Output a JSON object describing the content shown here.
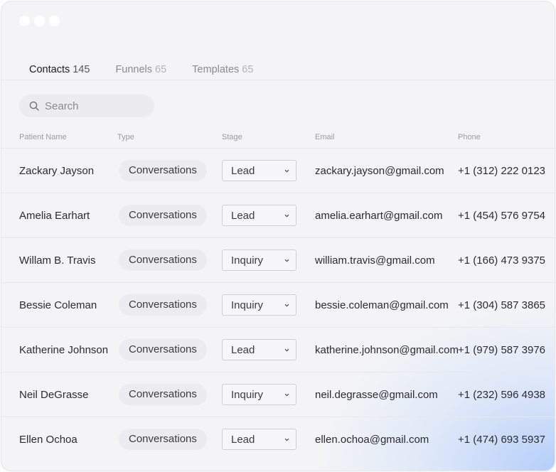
{
  "tabs": [
    {
      "label": "Contacts",
      "count": "145",
      "active": true
    },
    {
      "label": "Funnels",
      "count": "65",
      "active": false
    },
    {
      "label": "Templates",
      "count": "65",
      "active": false
    }
  ],
  "search": {
    "placeholder": "Search"
  },
  "columns": {
    "name": "Patient Name",
    "type": "Type",
    "stage": "Stage",
    "email": "Email",
    "phone": "Phone"
  },
  "rows": [
    {
      "name": "Zackary Jayson",
      "type": "Conversations",
      "stage": "Lead",
      "email": "zackary.jayson@gmail.com",
      "phone": "+1 (312) 222 0123"
    },
    {
      "name": "Amelia Earhart",
      "type": "Conversations",
      "stage": "Lead",
      "email": "amelia.earhart@gmail.com",
      "phone": "+1 (454) 576 9754"
    },
    {
      "name": "Willam B. Travis",
      "type": "Conversations",
      "stage": "Inquiry",
      "email": "william.travis@gmail.com",
      "phone": "+1 (166) 473 9375"
    },
    {
      "name": "Bessie Coleman",
      "type": "Conversations",
      "stage": "Inquiry",
      "email": "bessie.coleman@gmail.com",
      "phone": "+1 (304) 587 3865"
    },
    {
      "name": "Katherine Johnson",
      "type": "Conversations",
      "stage": "Lead",
      "email": "katherine.johnson@gmail.com",
      "phone": "+1 (979) 587 3976"
    },
    {
      "name": "Neil DeGrasse",
      "type": "Conversations",
      "stage": "Inquiry",
      "email": "neil.degrasse@gmail.com",
      "phone": "+1 (232) 596 4938"
    },
    {
      "name": "Ellen Ochoa",
      "type": "Conversations",
      "stage": "Lead",
      "email": "ellen.ochoa@gmail.com",
      "phone": "+1 (474) 693 5937"
    }
  ]
}
